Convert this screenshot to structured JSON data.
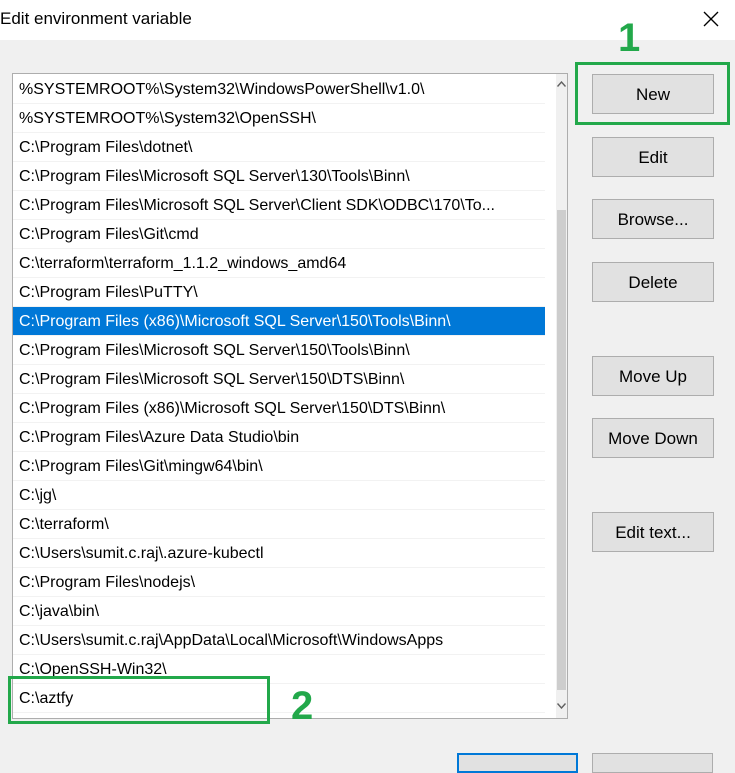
{
  "window": {
    "title": "Edit environment variable",
    "close_icon": "close-icon"
  },
  "paths": [
    "%SYSTEMROOT%\\System32\\WindowsPowerShell\\v1.0\\",
    "%SYSTEMROOT%\\System32\\OpenSSH\\",
    "C:\\Program Files\\dotnet\\",
    "C:\\Program Files\\Microsoft SQL Server\\130\\Tools\\Binn\\",
    "C:\\Program Files\\Microsoft SQL Server\\Client SDK\\ODBC\\170\\To...",
    "C:\\Program Files\\Git\\cmd",
    "C:\\terraform\\terraform_1.1.2_windows_amd64",
    "C:\\Program Files\\PuTTY\\",
    "C:\\Program Files (x86)\\Microsoft SQL Server\\150\\Tools\\Binn\\",
    "C:\\Program Files\\Microsoft SQL Server\\150\\Tools\\Binn\\",
    "C:\\Program Files\\Microsoft SQL Server\\150\\DTS\\Binn\\",
    "C:\\Program Files (x86)\\Microsoft SQL Server\\150\\DTS\\Binn\\",
    "C:\\Program Files\\Azure Data Studio\\bin",
    "C:\\Program Files\\Git\\mingw64\\bin\\",
    "C:\\jg\\",
    "C:\\terraform\\",
    "C:\\Users\\sumit.c.raj\\.azure-kubectl",
    "C:\\Program Files\\nodejs\\",
    "C:\\java\\bin\\",
    "C:\\Users\\sumit.c.raj\\AppData\\Local\\Microsoft\\WindowsApps",
    "C:\\OpenSSH-Win32\\",
    "C:\\aztfy"
  ],
  "selected_index": 8,
  "buttons": {
    "new": "New",
    "edit": "Edit",
    "browse": "Browse...",
    "delete": "Delete",
    "move_up": "Move Up",
    "move_down": "Move Down",
    "edit_text": "Edit text..."
  },
  "annotations": {
    "step1": "1",
    "step2": "2",
    "color": "#22a84a"
  },
  "colors": {
    "selection": "#0078d7"
  }
}
